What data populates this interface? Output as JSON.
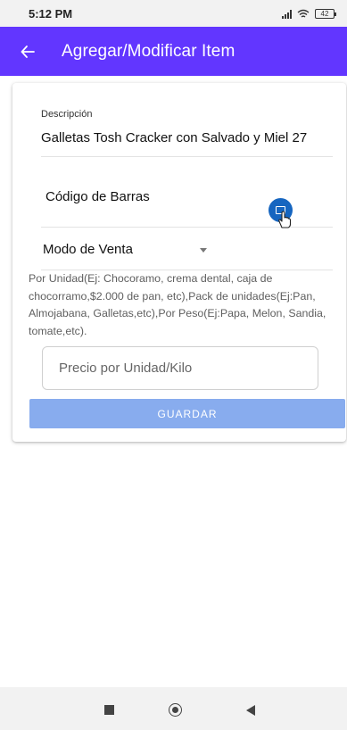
{
  "status_bar": {
    "time": "5:12 PM",
    "battery": "42",
    "icons": [
      "signal-icon",
      "wifi-icon",
      "battery-icon"
    ]
  },
  "app_bar": {
    "title": "Agregar/Modificar Item",
    "back_icon": "arrow-left-icon",
    "color": "#6236ff"
  },
  "form": {
    "descripcion_label": "Descripción",
    "descripcion_value": "Galletas Tosh Cracker con Salvado y Miel 27",
    "codigo_label": "Código de Barras",
    "scan_icon": "barcode-scan-icon",
    "modo_label": "Modo de Venta",
    "help_text": "Por Unidad(Ej: Chocoramo, crema dental, caja de chocorramo,$2.000 de pan, etc),Pack de unidades(Ej:Pan, Almojabana, Galletas,etc),Por Peso(Ej:Papa, Melon, Sandia, tomate,etc).",
    "precio_placeholder": "Precio por Unidad/Kilo",
    "guardar_label": "GUARDAR",
    "guardar_color": "#88acee"
  },
  "nav_bar": {
    "icons": [
      "recent-apps-icon",
      "home-icon",
      "back-icon"
    ]
  }
}
